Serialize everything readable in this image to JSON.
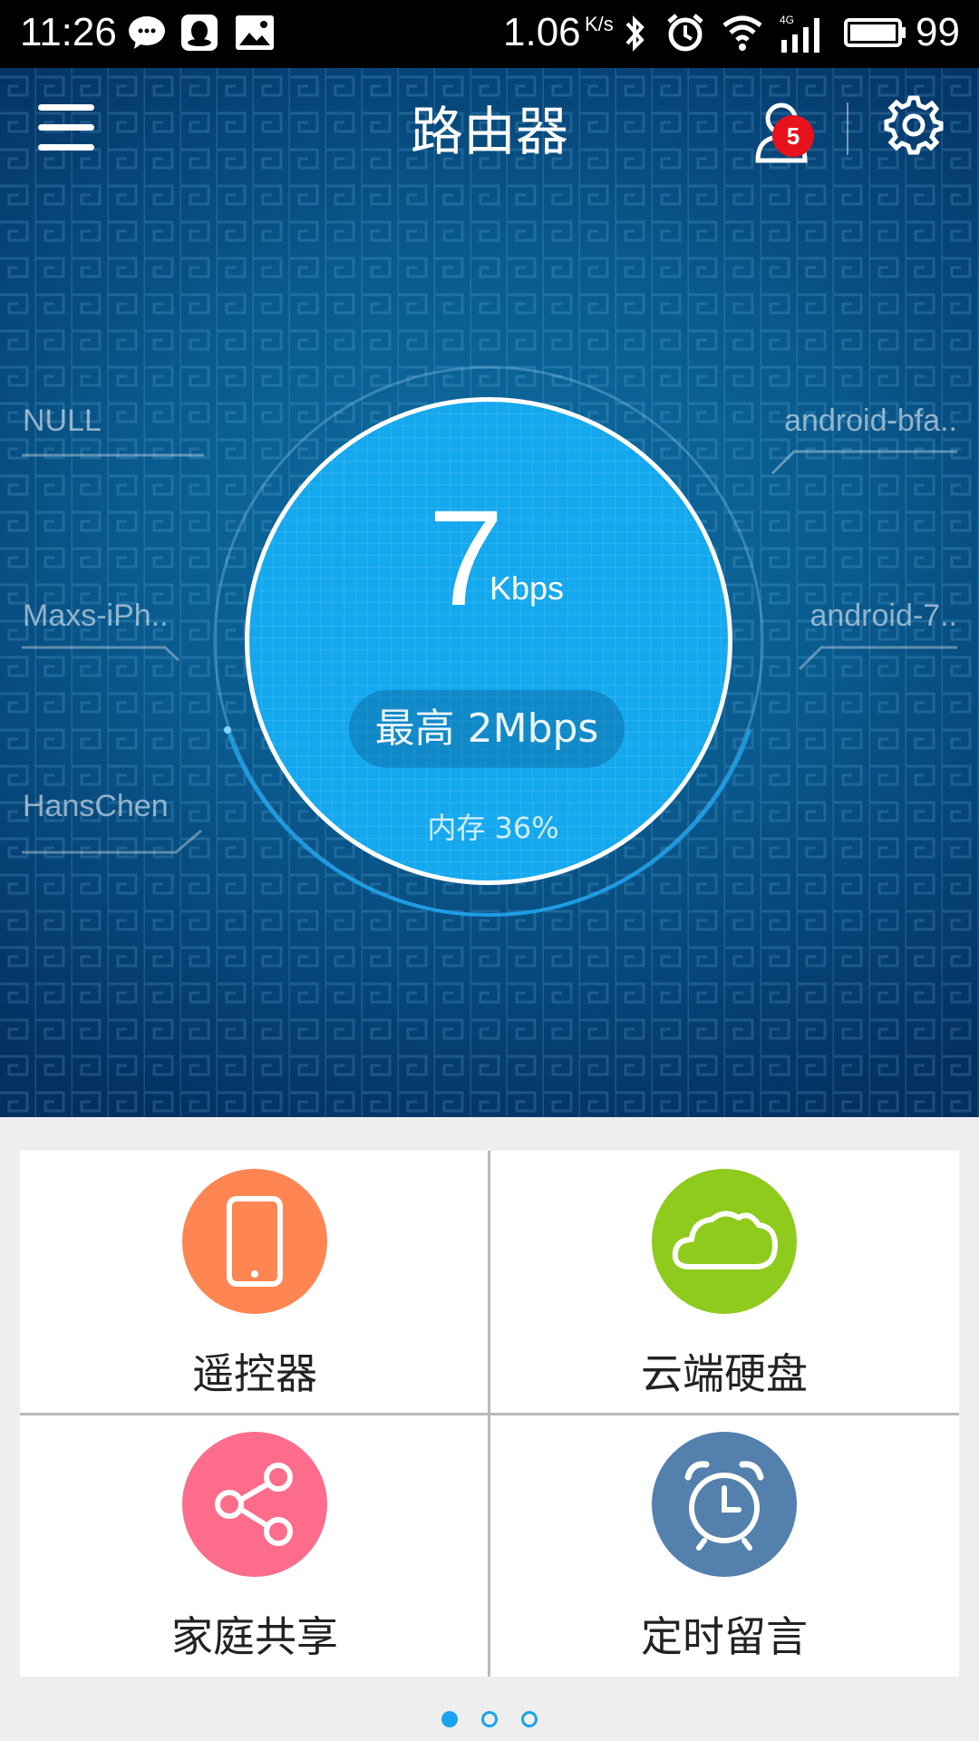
{
  "status_bar": {
    "time": "11:26",
    "net_speed": "1.06",
    "net_speed_unit": "K/s",
    "battery": "99",
    "icons": [
      "wechat-icon",
      "qq-icon",
      "image-icon",
      "bluetooth-icon",
      "alarm-icon",
      "wifi-icon",
      "4g-signal-icon",
      "battery-icon"
    ]
  },
  "header": {
    "title": "路由器",
    "notification_count": "5",
    "icons": [
      "menu-icon",
      "user-icon",
      "gear-icon"
    ]
  },
  "devices": {
    "left": [
      "NULL",
      "Maxs-iPh..",
      "HansChen"
    ],
    "right": [
      "android-bfa..",
      "android-7.."
    ]
  },
  "gauge": {
    "value": "7",
    "unit": "Kbps",
    "peak": "最高 2Mbps",
    "memory": "内存 36%",
    "colors": {
      "fill": "#14a8ee",
      "ring": "#ffffff"
    }
  },
  "tiles": [
    {
      "label": "遥控器",
      "icon": "phone-icon",
      "color": "#ff8553"
    },
    {
      "label": "云端硬盘",
      "icon": "cloud-icon",
      "color": "#8ecb1c"
    },
    {
      "label": "家庭共享",
      "icon": "share-icon",
      "color": "#fe6c8c"
    },
    {
      "label": "定时留言",
      "icon": "alarm-clock-icon",
      "color": "#5480ad"
    }
  ],
  "pagination": {
    "pages": 3,
    "current": 1
  }
}
